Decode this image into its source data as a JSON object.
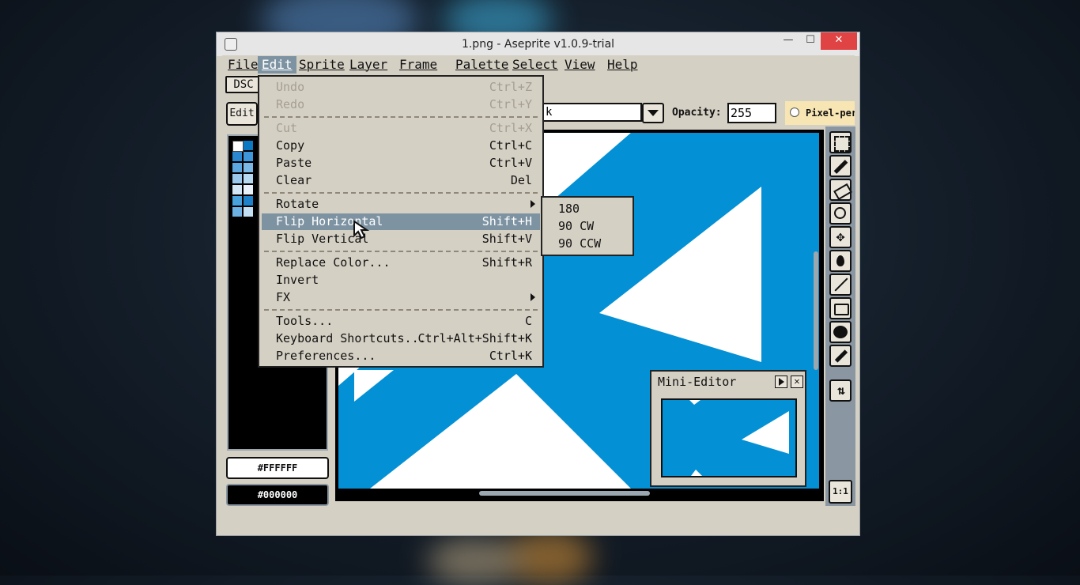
{
  "window": {
    "title": "1.png - Aseprite v1.0.9-trial",
    "minimize": "—",
    "maximize": "☐",
    "close": "✕"
  },
  "menubar": [
    {
      "label": "File"
    },
    {
      "label": "Edit"
    },
    {
      "label": "Sprite"
    },
    {
      "label": "Layer"
    },
    {
      "label": "Frame"
    },
    {
      "label": "Palette"
    },
    {
      "label": "Select"
    },
    {
      "label": "View"
    },
    {
      "label": "Help"
    }
  ],
  "tabs": {
    "file_tab": "DSC"
  },
  "toolbar": {
    "edit_button": "Edit",
    "ink_value": "k",
    "opacity_label": "Opacity:",
    "opacity_value": "255",
    "pixel_perfect_label": "Pixel-per"
  },
  "colors": {
    "foreground": "#FFFFFF",
    "background": "#000000",
    "accent": "#0390d5",
    "menu_highlight": "#7e93a2"
  },
  "edit_menu": {
    "undo": {
      "label": "Undo",
      "shortcut": "Ctrl+Z"
    },
    "redo": {
      "label": "Redo",
      "shortcut": "Ctrl+Y"
    },
    "cut": {
      "label": "Cut",
      "shortcut": "Ctrl+X"
    },
    "copy": {
      "label": "Copy",
      "shortcut": "Ctrl+C"
    },
    "paste": {
      "label": "Paste",
      "shortcut": "Ctrl+V"
    },
    "clear": {
      "label": "Clear",
      "shortcut": "Del"
    },
    "rotate": {
      "label": "Rotate"
    },
    "flip_h": {
      "label": "Flip Horizontal",
      "shortcut": "Shift+H"
    },
    "flip_v": {
      "label": "Flip Vertical",
      "shortcut": "Shift+V"
    },
    "replace_color": {
      "label": "Replace Color...",
      "shortcut": "Shift+R"
    },
    "invert": {
      "label": "Invert"
    },
    "fx": {
      "label": "FX"
    },
    "tools": {
      "label": "Tools...",
      "shortcut": "C"
    },
    "keyboard_shortcuts": {
      "label": "Keyboard Shortcuts...",
      "shortcut": "Ctrl+Alt+Shift+K"
    },
    "preferences": {
      "label": "Preferences...",
      "shortcut": "Ctrl+K"
    }
  },
  "rotate_submenu": [
    "180",
    "90 CW",
    "90 CCW"
  ],
  "mini_editor": {
    "title": "Mini-Editor"
  },
  "zoom_button": "1:1",
  "icons": [
    "marquee-icon",
    "pencil-icon",
    "eraser-icon",
    "zoom-icon",
    "move-icon",
    "fill-icon",
    "line-icon",
    "rectangle-icon",
    "blur-icon",
    "spray-icon",
    "config-icon"
  ]
}
